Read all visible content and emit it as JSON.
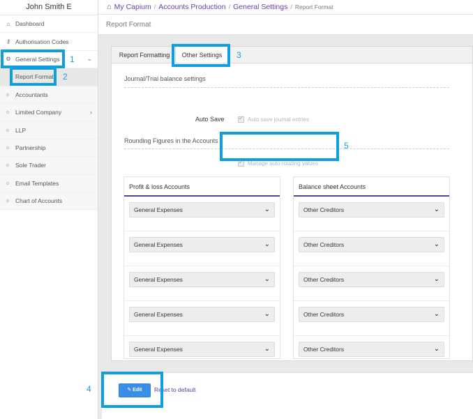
{
  "sidebar": {
    "user_name": "John Smith E",
    "items": [
      {
        "label": "Dashboard",
        "icon": "home-icon"
      },
      {
        "label": "Authorisation Codes",
        "icon": "key-icon"
      },
      {
        "label": "General Settings",
        "icon": "gears-icon"
      },
      {
        "label": "Report Format"
      },
      {
        "label": "Accountants"
      },
      {
        "label": "Limited Company"
      },
      {
        "label": "LLP"
      },
      {
        "label": "Partnership"
      },
      {
        "label": "Sole Trader"
      },
      {
        "label": "Email Templates"
      },
      {
        "label": "Chart of Accounts"
      }
    ]
  },
  "breadcrumb": {
    "items": [
      "My Capium",
      "Accounts Production",
      "General Settings"
    ],
    "current": "Report Format"
  },
  "page_title": "Report Format",
  "tabs": [
    {
      "label": "Report Formatting"
    },
    {
      "label": "Other Settings",
      "active": true
    }
  ],
  "journal_section": {
    "title": "Journal/Trial balance settings",
    "auto_save_label": "Auto Save",
    "auto_save_checkbox_label": "Auto save journal entries"
  },
  "rounding_section": {
    "title": "Rounding Figures in the Accounts",
    "manage_checkbox_label": "Manage auto rouding values"
  },
  "profit_loss": {
    "header": "Profit & loss Accounts",
    "selects": [
      "General Expenses",
      "General Expenses",
      "General Expenses",
      "General Expenses",
      "General Expenses"
    ]
  },
  "balance_sheet": {
    "header": "Balance sheet Accounts",
    "selects": [
      "Other Creditors",
      "Other Creditors",
      "Other Creditors",
      "Other Creditors",
      "Other Creditors"
    ]
  },
  "footer": {
    "edit_label": "Edit",
    "reset_label": "Reset to default"
  },
  "callouts": [
    "1",
    "2",
    "3",
    "4",
    "5"
  ],
  "colors": {
    "brand_purple": "#5b3d9a",
    "callout_blue": "#0f9fe0",
    "button_blue": "#3a8ee8"
  }
}
